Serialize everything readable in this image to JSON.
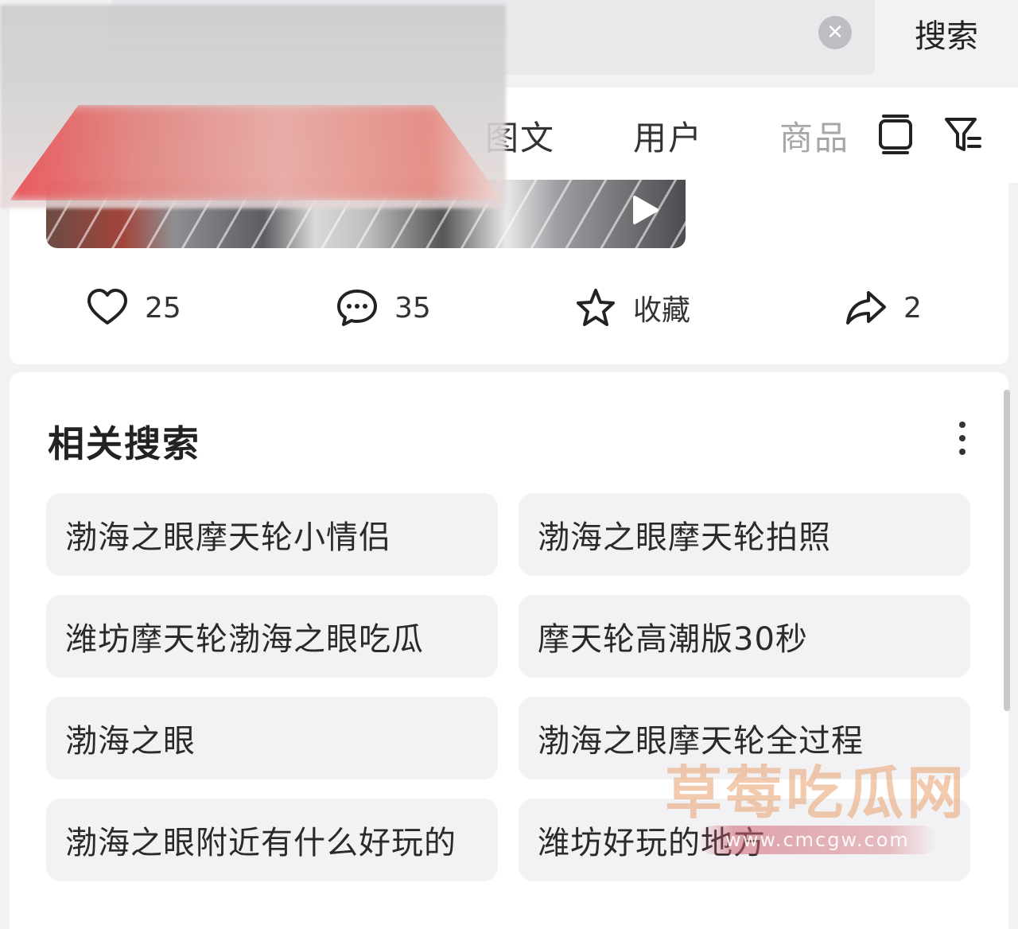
{
  "search": {
    "clear_label": "✕",
    "submit_label": "搜索"
  },
  "tabs": [
    {
      "label": "图文",
      "active": false
    },
    {
      "label": "用户",
      "active": false
    },
    {
      "label": "商品",
      "active": false
    }
  ],
  "icons": {
    "layout": "layout-toggle-icon",
    "filter": "filter-icon",
    "play": "play-icon",
    "like": "heart-icon",
    "comment": "comment-icon",
    "favorite": "star-icon",
    "share": "share-icon",
    "more": "more-vertical-icon"
  },
  "post": {
    "likes": "25",
    "comments": "35",
    "favorite_label": "收藏",
    "shares": "2"
  },
  "related": {
    "title": "相关搜索",
    "items": [
      "渤海之眼摩天轮小情侣",
      "渤海之眼摩天轮拍照",
      "潍坊摩天轮渤海之眼吃瓜",
      "摩天轮高潮版30秒",
      "渤海之眼",
      "渤海之眼摩天轮全过程",
      "渤海之眼附近有什么好玩的",
      "潍坊好玩的地方"
    ]
  },
  "watermark": {
    "text": "草莓吃瓜网",
    "url": "www.cmcgw.com"
  },
  "colors": {
    "background": "#f2f2f4",
    "card": "#ffffff",
    "chip": "#f2f2f4",
    "muted_tab": "#a7a7ab",
    "watermark": "#e8a06e"
  }
}
